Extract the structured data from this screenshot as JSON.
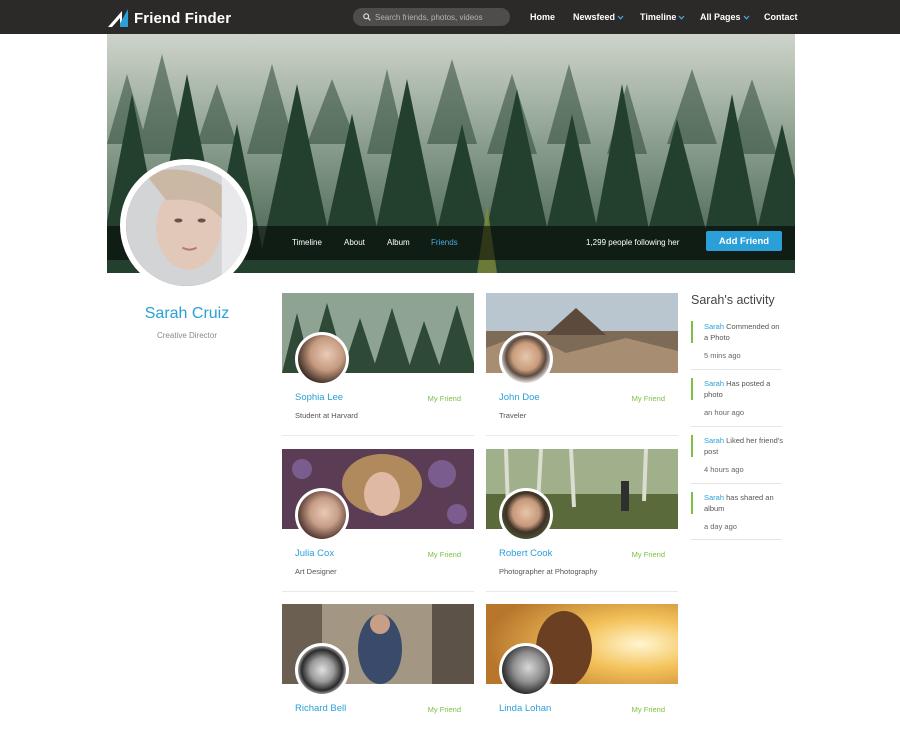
{
  "app": {
    "logo_text": "Friend Finder"
  },
  "search": {
    "placeholder": "Search friends, photos, videos"
  },
  "nav": [
    {
      "label": "Home",
      "has_dropdown": false
    },
    {
      "label": "Newsfeed",
      "has_dropdown": true
    },
    {
      "label": "Timeline",
      "has_dropdown": true
    },
    {
      "label": "All Pages",
      "has_dropdown": true
    },
    {
      "label": "Contact",
      "has_dropdown": false
    }
  ],
  "cover": {
    "tabs": [
      "Timeline",
      "About",
      "Album",
      "Friends"
    ],
    "active_tab": "Friends",
    "followers_text": "1,299 people following her",
    "add_friend_label": "Add Friend"
  },
  "profile": {
    "name": "Sarah Cruiz",
    "role": "Creative Director"
  },
  "friends": [
    {
      "name": "Sophia Lee",
      "desc": "Student at Harvard",
      "status": "My Friend"
    },
    {
      "name": "John Doe",
      "desc": "Traveler",
      "status": "My Friend"
    },
    {
      "name": "Julia Cox",
      "desc": "Art Designer",
      "status": "My Friend"
    },
    {
      "name": "Robert Cook",
      "desc": "Photographer at Photography",
      "status": "My Friend"
    },
    {
      "name": "Richard Bell",
      "desc": "",
      "status": "My Friend"
    },
    {
      "name": "Linda Lohan",
      "desc": "",
      "status": "My Friend"
    }
  ],
  "activity": {
    "title": "Sarah's activity",
    "items": [
      {
        "who": "Sarah",
        "text": "Commended on a Photo",
        "time": "5 mins ago"
      },
      {
        "who": "Sarah",
        "text": "Has posted a photo",
        "time": "an hour ago"
      },
      {
        "who": "Sarah",
        "text": "Liked her friend's post",
        "time": "4 hours ago"
      },
      {
        "who": "Sarah",
        "text": "has shared an album",
        "time": "a day ago"
      }
    ]
  },
  "colors": {
    "accent": "#2a9fd8",
    "friend_green": "#7bc043",
    "topbar": "#2b2a29"
  }
}
